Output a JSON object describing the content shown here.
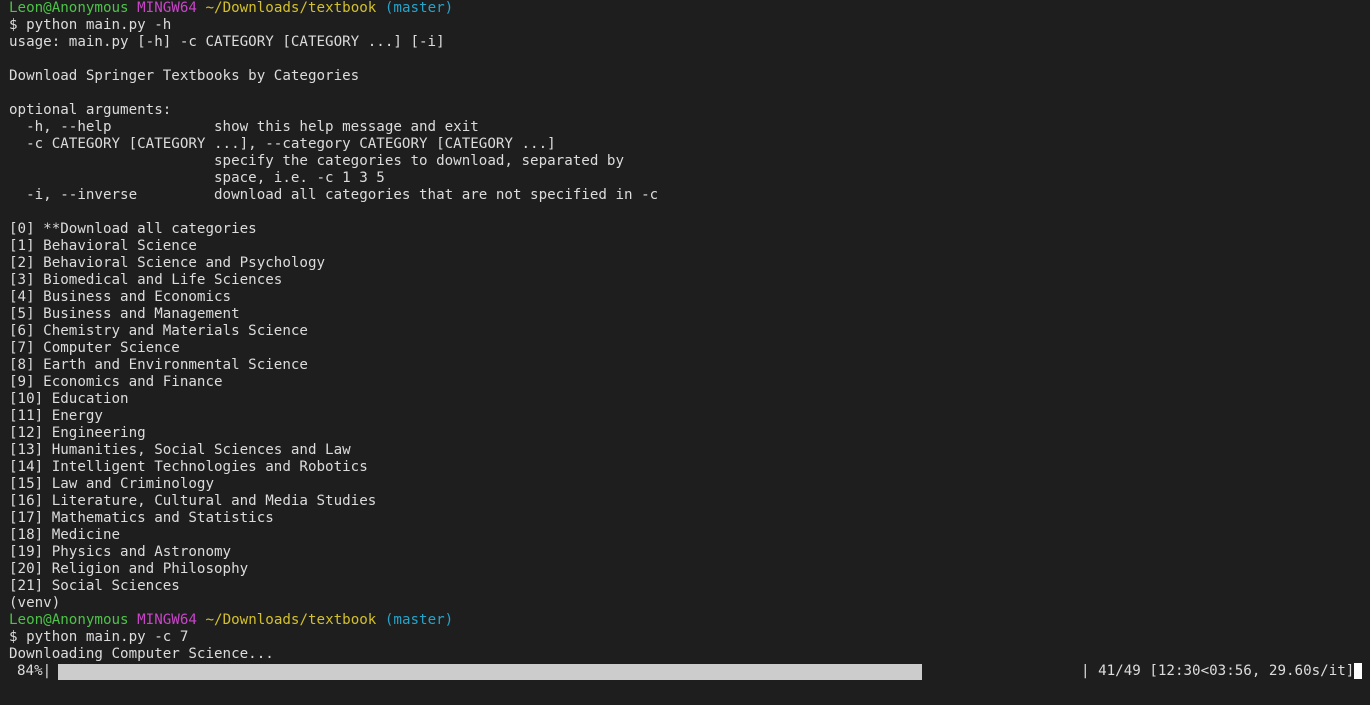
{
  "prompt": {
    "user": "Leon@Anonymous",
    "host": "MINGW64",
    "path": "~/Downloads/textbook",
    "branch": "(master)",
    "symbol": "$"
  },
  "commands": [
    "python main.py -h",
    "python main.py -c 7"
  ],
  "help": {
    "usage": "usage: main.py [-h] -c CATEGORY [CATEGORY ...] [-i]",
    "description": "Download Springer Textbooks by Categories",
    "section": "optional arguments:",
    "lines": [
      "  -h, --help            show this help message and exit",
      "  -c CATEGORY [CATEGORY ...], --category CATEGORY [CATEGORY ...]",
      "                        specify the categories to download, separated by",
      "                        space, i.e. -c 1 3 5",
      "  -i, --inverse         download all categories that are not specified in -c"
    ]
  },
  "categories": [
    "[0] **Download all categories",
    "[1] Behavioral Science",
    "[2] Behavioral Science and Psychology",
    "[3] Biomedical and Life Sciences",
    "[4] Business and Economics",
    "[5] Business and Management",
    "[6] Chemistry and Materials Science",
    "[7] Computer Science",
    "[8] Earth and Environmental Science",
    "[9] Economics and Finance",
    "[10] Education",
    "[11] Energy",
    "[12] Engineering",
    "[13] Humanities, Social Sciences and Law",
    "[14] Intelligent Technologies and Robotics",
    "[15] Law and Criminology",
    "[16] Literature, Cultural and Media Studies",
    "[17] Mathematics and Statistics",
    "[18] Medicine",
    "[19] Physics and Astronomy",
    "[20] Religion and Philosophy",
    "[21] Social Sciences"
  ],
  "venv": "(venv)",
  "downloading": "Downloading Computer Science...",
  "progress": {
    "percent_label": "84%|",
    "fraction": 0.84,
    "stats": "| 41/49 [12:30<03:56, 29.60s/it]"
  },
  "colors": {
    "background": "#1e1e1e",
    "text": "#dcdcdc",
    "user": "#4ec24a",
    "host": "#c845c8",
    "path": "#d2c02c",
    "branch": "#27a3c9",
    "bar": "#cccccc"
  }
}
